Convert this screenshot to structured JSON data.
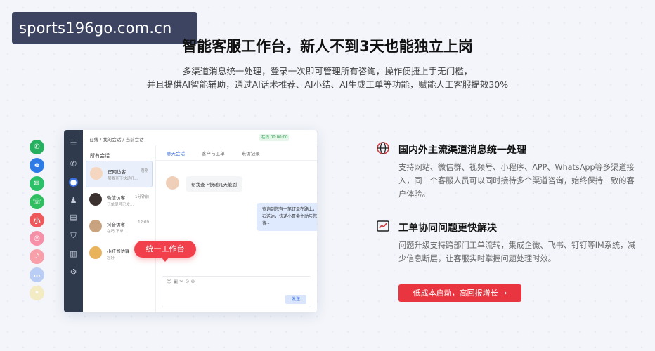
{
  "watermark": "sports196go.com.cn",
  "title": "智能客服工作台，新人不到3天也能独立上岗",
  "subtitle": {
    "line1": "多渠道消息统一处理，登录一次即可管理所有咨询，操作便捷上手无门槛，",
    "line2": "并且提供AI智能辅助，通过AI话术推荐、AI小结、AI生成工单等功能，赋能人工客服提效30%"
  },
  "channels": [
    {
      "name": "phone",
      "color": "#25b05f",
      "glyph": "✆"
    },
    {
      "name": "ie",
      "color": "#2f7be6",
      "glyph": "e"
    },
    {
      "name": "wechat",
      "color": "#2bc169",
      "glyph": "✉"
    },
    {
      "name": "whatsapp",
      "color": "#2fbf60",
      "glyph": "☏"
    },
    {
      "name": "xiaohongshu",
      "color": "#f0575a",
      "glyph": "小"
    },
    {
      "name": "instagram",
      "color": "#f590a8",
      "glyph": "◎"
    },
    {
      "name": "tiktok",
      "color": "#f7a0aa",
      "glyph": "♪"
    },
    {
      "name": "message",
      "color": "#b9cdf5",
      "glyph": "…"
    },
    {
      "name": "other",
      "color": "#f3ebc4",
      "glyph": "•"
    }
  ],
  "app": {
    "breadcrumb": "在线 / 我的会话 / 当前会话",
    "status": "在线 00:00:00",
    "list_header": "所有会话",
    "conversations": [
      {
        "name": "官网访客",
        "time": "刚刚",
        "preview": "帮我查下快递几..."
      },
      {
        "name": "微信访客",
        "time": "1分钟前",
        "preview": "订单尾号已发..."
      },
      {
        "name": "抖音访客",
        "time": "12:09",
        "preview": "在吗 下单..."
      },
      {
        "name": "小红书访客",
        "time": "",
        "preview": "您好"
      }
    ],
    "tabs": [
      "聊天会话",
      "客户与工单",
      "来访记录"
    ],
    "msg_in": "帮我查下快递几天能到",
    "msg_out": "查询到您有一笔订单在路上，预计今天下午3点左右送达，快递小哥会主动与您联系，请您耐心等待~",
    "input_tools": "☺ ▣ ✂ ⊙ ⊕",
    "send": "发送",
    "tag": "统一工作台"
  },
  "features": [
    {
      "title": "国内外主流渠道消息统一处理",
      "desc": "支持网站、微信群、视频号、小程序、APP、WhatsApp等多渠道接入，同一个客服人员可以同时接待多个渠道咨询，始终保持一致的客户体验。"
    },
    {
      "title": "工单协同问题更快解决",
      "desc": "问题升级支持跨部门工单流转，集成企微、飞书、钉钉等IM系统，减少信息断层，让客服实时掌握问题处理时效。"
    }
  ],
  "cta": "低成本启动，高回报增长 →",
  "colors": {
    "accent": "#e9353f",
    "link": "#3b6fe0",
    "rail": "#2f3a4d"
  }
}
